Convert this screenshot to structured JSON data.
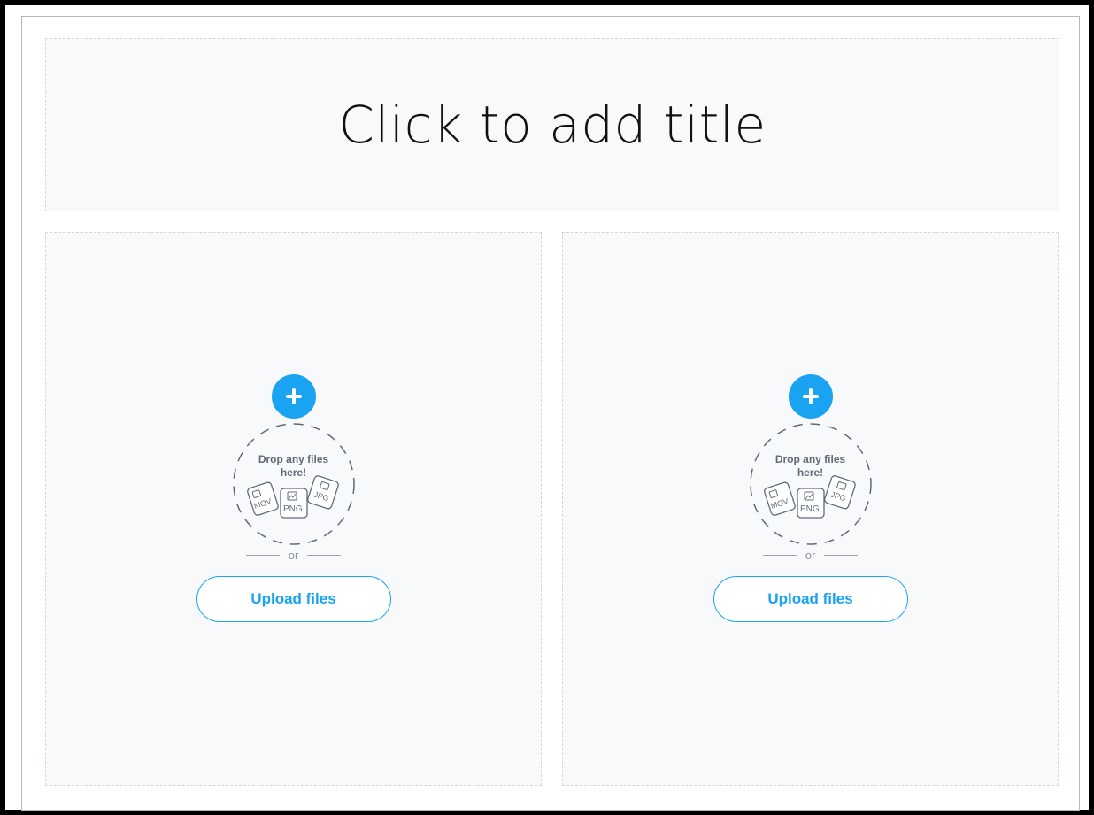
{
  "title_placeholder": {
    "text": "Click to add title"
  },
  "placeholders": [
    {
      "drop_text_line1": "Drop any files",
      "drop_text_line2": "here!",
      "file_labels": [
        "MOV",
        "PNG",
        "JPG"
      ],
      "separator": "or",
      "upload_label": "Upload files"
    },
    {
      "drop_text_line1": "Drop any files",
      "drop_text_line2": "here!",
      "file_labels": [
        "MOV",
        "PNG",
        "JPG"
      ],
      "separator": "or",
      "upload_label": "Upload files"
    }
  ],
  "colors": {
    "accent": "#1aa3f0",
    "placeholder_bg": "#f8f9fb",
    "placeholder_border": "#d3d6db",
    "muted_text": "#5f6b78"
  },
  "icons": {
    "add": "plus-circle-icon",
    "files": "file-stack-icon"
  }
}
